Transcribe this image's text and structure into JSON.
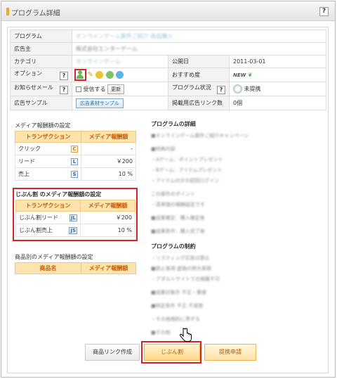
{
  "window": {
    "title": "プログラム詳細",
    "help_label": "?"
  },
  "info": {
    "program_label": "プログラム",
    "program_value": "オンラインゲーム案件ご紹介 商品購入",
    "advertiser_label": "広告主",
    "advertiser_value": "株式会社エンターゲーム",
    "category_label": "カテゴリ",
    "category_value": "オンラインゲーム",
    "pubdate_label": "公開日",
    "pubdate_value": "2011-03-01",
    "option_label": "オプション",
    "recommend_label": "おすすめ度",
    "recommend_badge": "NEW",
    "notify_label": "お知らせメール",
    "notify_checkbox_label": "受信する",
    "notify_update": "更新",
    "status_label": "プログラム状況",
    "status_value": "未提携",
    "sample_label": "広告サンプル",
    "sample_button": "広告素材サンプル",
    "linkcount_label": "掲載用広告リンク数",
    "linkcount_value": "0個",
    "help_q": "?"
  },
  "media_rates": {
    "title": "メディア報酬額の設定",
    "col_transaction": "トランザクション",
    "col_reward": "メディア報酬額",
    "rows": [
      {
        "name": "クリック",
        "icon": "C",
        "value": "-"
      },
      {
        "name": "リード",
        "icon": "L",
        "value": "￥200"
      },
      {
        "name": "売上",
        "icon": "S",
        "value": "10 %"
      }
    ]
  },
  "jibun_rates": {
    "title": "じぶん割 のメディア報酬額の設定",
    "col_transaction": "トランザクション",
    "col_reward": "メディア報酬額",
    "rows": [
      {
        "name": "じぶん割リード",
        "icon": "JL",
        "value": "￥200"
      },
      {
        "name": "じぶん割売上",
        "icon": "JS",
        "value": "10 %"
      }
    ]
  },
  "product_rates": {
    "title": "商品別のメディア報酬額の設定",
    "col_product": "商品名",
    "col_reward": "メディア報酬額"
  },
  "details": {
    "title": "プログラムの詳細",
    "lines": [
      "■オンラインゲーム案件ご紹介キャンペーン",
      "■特典内容",
      "・Aゲーム：ポイントプレゼント",
      "・Bゲーム：アイテムプレゼント",
      "・アイテム付きの初回ログイン",
      "この案件のポイント",
      "・高単価の報酬設定です",
      "■成果確定：購入確定後",
      "■成果条件：購入完了後"
    ],
    "restrictions_title": "プログラムの制約",
    "restriction_lines": [
      "・リスティング広告は禁止",
      "■禁止事項 虚偽の誇大表現",
      "・アダルトサイトでの掲載不可",
      "■成果対象外 不正・重複",
      "■特定条件 不正 不道徳",
      "・その他規約に準ずる",
      "■その他"
    ]
  },
  "actions": {
    "link_create": "商品リンク作成",
    "jibun": "じぶん割",
    "apply": "提携申請"
  },
  "colors": {
    "accent_orange": "#fde3ad",
    "highlight_red": "#d0262a",
    "link_blue": "#9cc6dc"
  }
}
